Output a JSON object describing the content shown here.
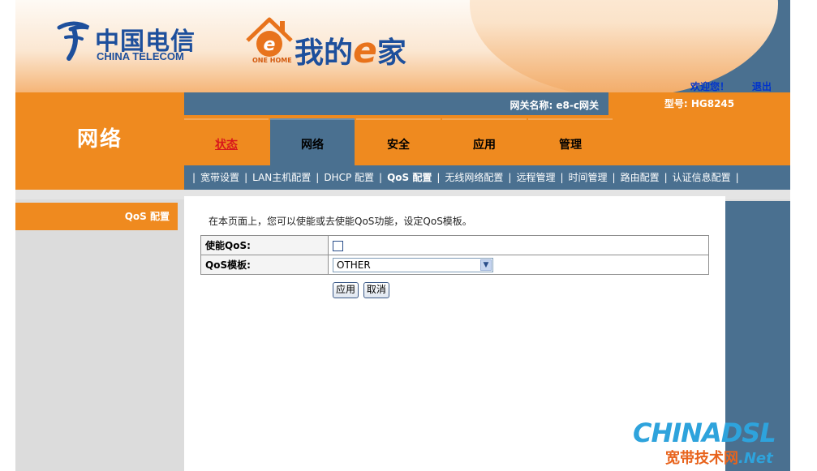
{
  "header": {
    "brand_cn": "中国电信",
    "brand_en": "CHINA TELECOM",
    "ehome_pre": "我的",
    "ehome_e": "e",
    "ehome_post": "家",
    "ehome_sub": "ONE HOME",
    "welcome": "欢迎您！",
    "logout": "退出"
  },
  "section_title": "网络",
  "gateway_name": "网关名称: e8-c网关",
  "model": "型号: HG8245",
  "tabs": [
    {
      "label": "状态"
    },
    {
      "label": "网络"
    },
    {
      "label": "安全"
    },
    {
      "label": "应用"
    },
    {
      "label": "管理"
    }
  ],
  "subnav": [
    "宽带设置",
    "LAN主机配置",
    "DHCP 配置",
    "QoS 配置",
    "无线网络配置",
    "远程管理",
    "时间管理",
    "路由配置",
    "认证信息配置"
  ],
  "sidebar": {
    "item": "QoS 配置"
  },
  "content": {
    "description": "在本页面上，您可以使能或去使能QoS功能，设定QoS模板。",
    "enable_label": "使能QoS:",
    "template_label": "QoS模板:",
    "template_value": "OTHER",
    "apply": "应用",
    "cancel": "取消"
  },
  "watermark": {
    "top": "CHINADSL",
    "bottom": "宽带技术网",
    "net": ".Net"
  },
  "colors": {
    "orange": "#ef8a1f",
    "steel": "#4a7090",
    "link": "#0033cc",
    "red": "#d8181c"
  }
}
